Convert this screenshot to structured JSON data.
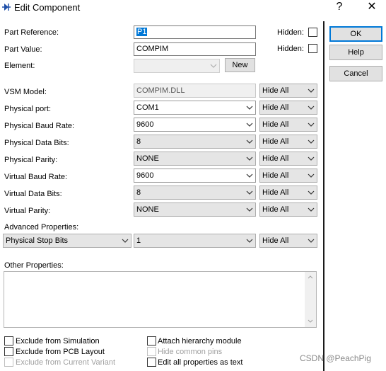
{
  "window": {
    "title": "Edit Component",
    "help_glyph": "?",
    "close_glyph": "✕"
  },
  "fields": {
    "part_reference": {
      "label": "Part Reference:",
      "value": "P1",
      "hidden_label": "Hidden:"
    },
    "part_value": {
      "label": "Part Value:",
      "value": "COMPIM",
      "hidden_label": "Hidden:"
    },
    "element": {
      "label": "Element:",
      "value": "",
      "new_button": "New"
    }
  },
  "properties": [
    {
      "label": "VSM Model:",
      "value": "COMPIM.DLL",
      "visibility": "Hide All"
    },
    {
      "label": "Physical port:",
      "value": "COM1",
      "visibility": "Hide All"
    },
    {
      "label": "Physical Baud Rate:",
      "value": "9600",
      "visibility": "Hide All"
    },
    {
      "label": "Physical Data Bits:",
      "value": "8",
      "visibility": "Hide All"
    },
    {
      "label": "Physical Parity:",
      "value": "NONE",
      "visibility": "Hide All"
    },
    {
      "label": "Virtual Baud Rate:",
      "value": "9600",
      "visibility": "Hide All"
    },
    {
      "label": "Virtual Data Bits:",
      "value": "8",
      "visibility": "Hide All"
    },
    {
      "label": "Virtual Parity:",
      "value": "NONE",
      "visibility": "Hide All"
    }
  ],
  "advanced": {
    "label": "Advanced Properties:",
    "property": "Physical Stop Bits",
    "value": "1",
    "visibility": "Hide All"
  },
  "other_properties": {
    "label": "Other Properties:",
    "value": ""
  },
  "checkboxes": {
    "exclude_simulation": "Exclude from Simulation",
    "exclude_pcb": "Exclude from PCB Layout",
    "exclude_variant": "Exclude from Current Variant",
    "attach_hierarchy": "Attach hierarchy module",
    "hide_common_pins": "Hide common pins",
    "edit_all_as_text": "Edit all properties as text"
  },
  "buttons": {
    "ok": "OK",
    "help": "Help",
    "cancel": "Cancel"
  },
  "watermark": "CSDN @PeachPig"
}
